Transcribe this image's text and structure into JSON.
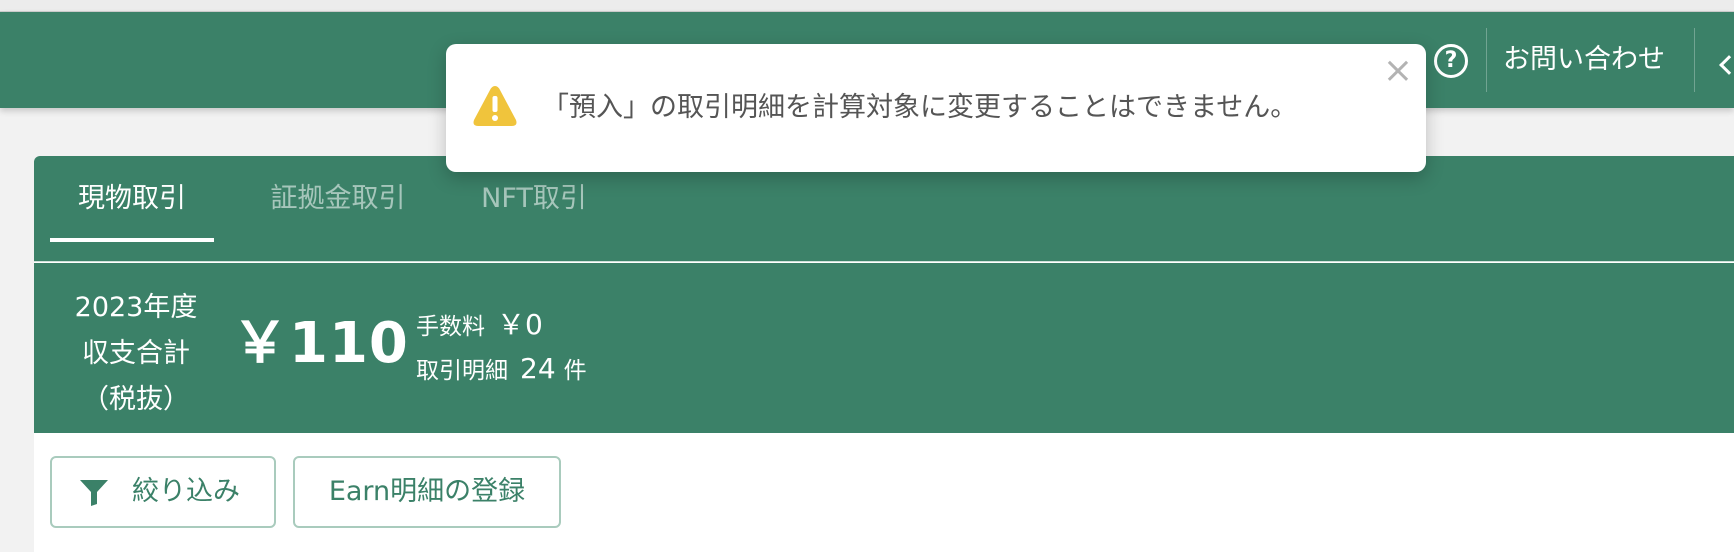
{
  "header": {
    "help_icon": "question-circle-icon",
    "contact_label": "お問い合わせ",
    "back_icon": "chevron-left-icon",
    "bg_color": "#3b8168"
  },
  "toast": {
    "icon": "warning-triangle-icon",
    "icon_color": "#f0c43c",
    "message": "「預入」の取引明細を計算対象に変更することはできません。",
    "close_icon": "close-icon",
    "close_label": "×"
  },
  "tabs": [
    {
      "label": "現物取引",
      "active": true
    },
    {
      "label": "証拠金取引",
      "active": false
    },
    {
      "label": "NFT取引",
      "active": false
    }
  ],
  "summary": {
    "fiscal_year": "2023年度",
    "total_line1": "収支合計",
    "total_line2": "（税抜）",
    "total_amount": "￥110",
    "fee_label": "手数料",
    "fee_value": "￥0",
    "tx_label": "取引明細",
    "tx_count": "24",
    "tx_unit": "件"
  },
  "actions": {
    "filter_icon": "funnel-icon",
    "filter_label": "絞り込み",
    "earn_label": "Earn明細の登録"
  }
}
